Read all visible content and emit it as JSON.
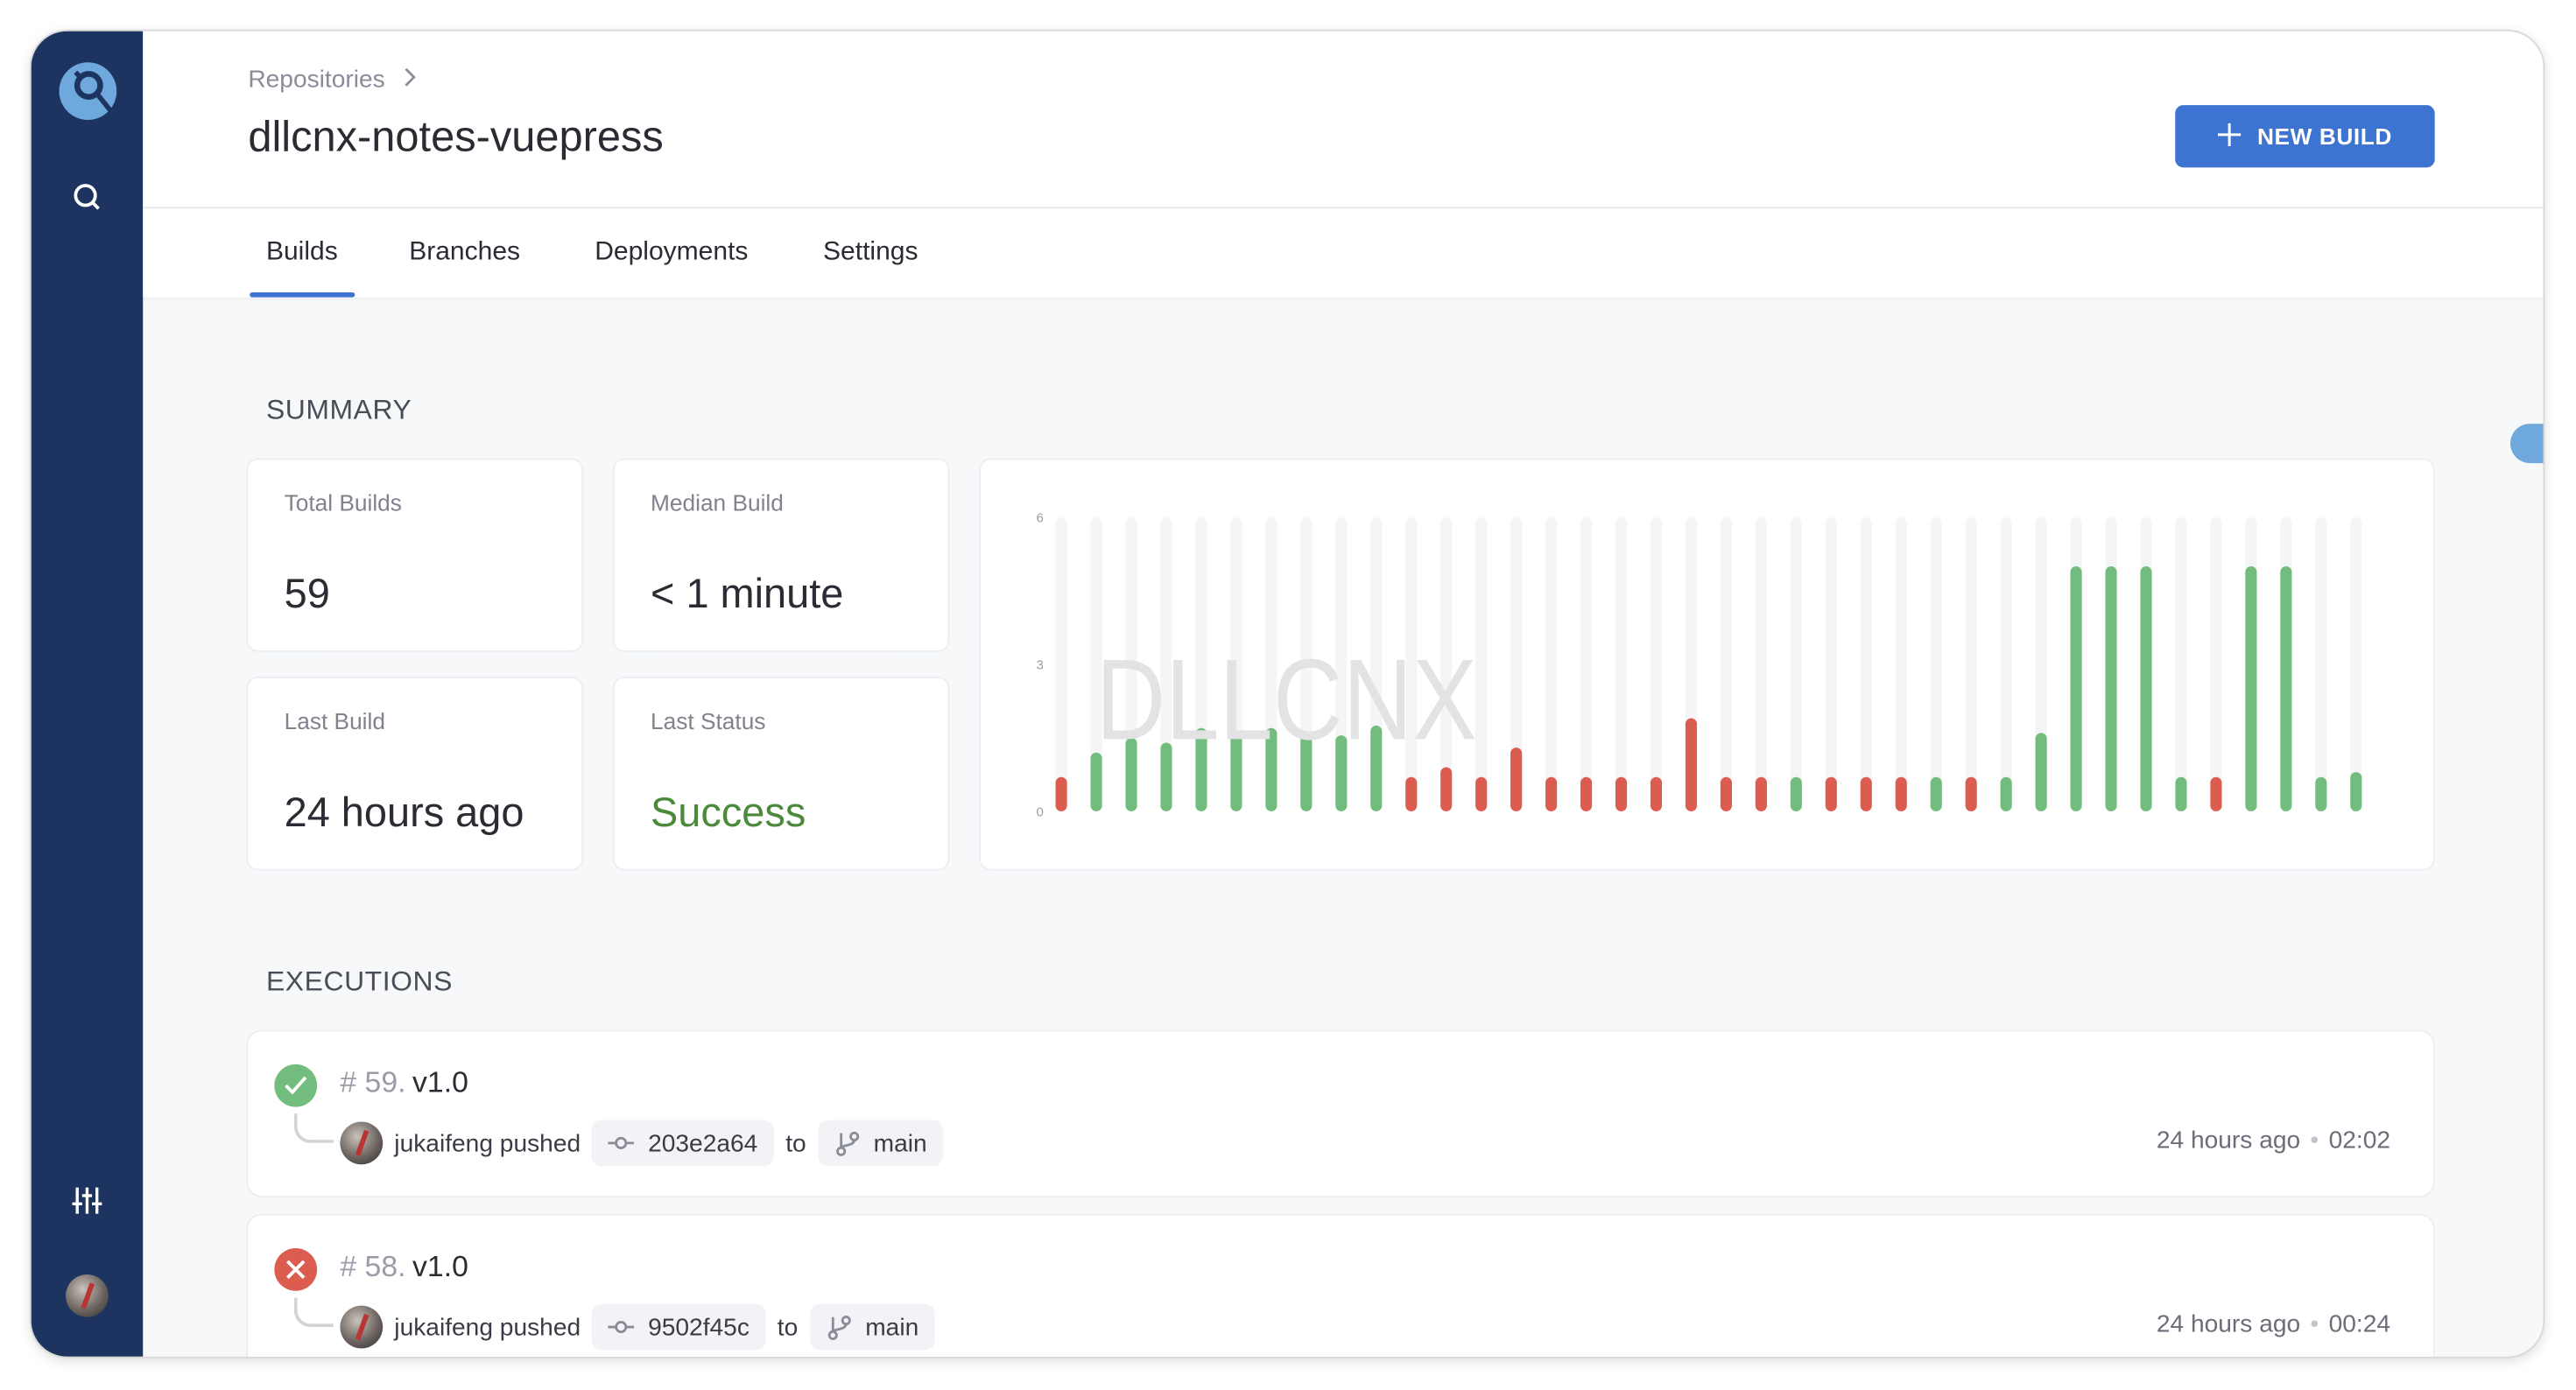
{
  "breadcrumb": {
    "items": [
      "Repositories"
    ]
  },
  "header": {
    "title": "dllcnx-notes-vuepress",
    "new_build_label": "NEW BUILD"
  },
  "tabs": [
    {
      "label": "Builds",
      "active": true
    },
    {
      "label": "Branches"
    },
    {
      "label": "Deployments"
    },
    {
      "label": "Settings"
    }
  ],
  "summary": {
    "title": "SUMMARY",
    "stats": [
      {
        "label": "Total Builds",
        "value": "59"
      },
      {
        "label": "Median Build",
        "value": "< 1 minute"
      },
      {
        "label": "Last Build",
        "value": "24 hours ago"
      },
      {
        "label": "Last Status",
        "value": "Success"
      }
    ]
  },
  "colors": {
    "sidebar": "#1d3461",
    "accent": "#3d73d1",
    "success": "#72bd7e",
    "failure": "#dc5d50",
    "success_text": "#4a8a3a"
  },
  "chart_data": {
    "type": "bar",
    "watermark": "DLLCNX",
    "yticks": [
      "0",
      "3",
      "6"
    ],
    "ylim": [
      0,
      6
    ],
    "grid": false,
    "values": [
      0.7,
      1.2,
      1.5,
      1.4,
      1.7,
      1.6,
      1.7,
      1.6,
      1.55,
      1.75,
      0.7,
      0.9,
      0.7,
      1.3,
      0.7,
      0.7,
      0.7,
      0.7,
      1.9,
      0.7,
      0.7,
      0.7,
      0.7,
      0.7,
      0.7,
      0.7,
      0.7,
      0.7,
      1.6,
      5.0,
      5.0,
      5.0,
      0.7,
      0.7,
      5.0,
      5.0,
      0.7,
      0.8
    ],
    "status": [
      "failure",
      "success",
      "success",
      "success",
      "success",
      "success",
      "success",
      "success",
      "success",
      "success",
      "failure",
      "failure",
      "failure",
      "failure",
      "failure",
      "failure",
      "failure",
      "failure",
      "failure",
      "failure",
      "failure",
      "success",
      "failure",
      "failure",
      "failure",
      "success",
      "failure",
      "success",
      "success",
      "success",
      "success",
      "success",
      "success",
      "failure",
      "success",
      "success",
      "success",
      "success"
    ]
  },
  "executions": {
    "title": "EXECUTIONS",
    "items": [
      {
        "number": "# 59.",
        "version": "v1.0",
        "status": "success",
        "author_text": "jukaifeng pushed",
        "commit": "203e2a64",
        "to": "to",
        "branch": "main",
        "time": "24 hours ago",
        "duration": "02:02"
      },
      {
        "number": "# 58.",
        "version": "v1.0",
        "status": "failure",
        "author_text": "jukaifeng pushed",
        "commit": "9502f45c",
        "to": "to",
        "branch": "main",
        "time": "24 hours ago",
        "duration": "00:24"
      }
    ]
  }
}
